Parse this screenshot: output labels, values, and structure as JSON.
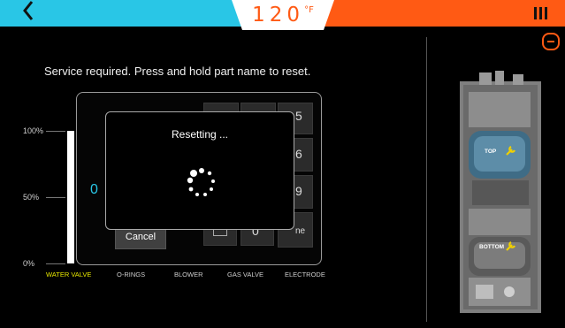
{
  "header": {
    "temperature": "120",
    "unit": "°F",
    "colors": {
      "left": "#29c6e6",
      "right": "#ff5a14"
    },
    "back_icon": "chevron-left-icon",
    "menu_icon": "menu-icon",
    "minus_icon": "minus-circle-icon"
  },
  "instruction": "Service required. Press and hold part name to reset.",
  "chart_data": {
    "type": "bar",
    "categories": [
      "WATER VALVE",
      "O-RINGS",
      "BLOWER",
      "GAS VALVE",
      "ELECTRODE"
    ],
    "values": [
      100,
      null,
      null,
      null,
      null
    ],
    "ylim": [
      0,
      100
    ],
    "yticks": [
      "100%",
      "50%",
      "0%"
    ],
    "highlight": "WATER VALVE",
    "highlight_color": "#e8e800"
  },
  "background_dialog": {
    "left_value": "0",
    "cancel_label": "Cancel",
    "partial_digits": [
      "5",
      "6",
      "9",
      "0"
    ],
    "partial_label": "ne"
  },
  "modal": {
    "title": "Resetting ...",
    "spinner_icon": "loading-spinner-icon"
  },
  "heater": {
    "top_label": "TOP",
    "bottom_label": "BOTTOM",
    "wrench_icon": "wrench-icon"
  }
}
